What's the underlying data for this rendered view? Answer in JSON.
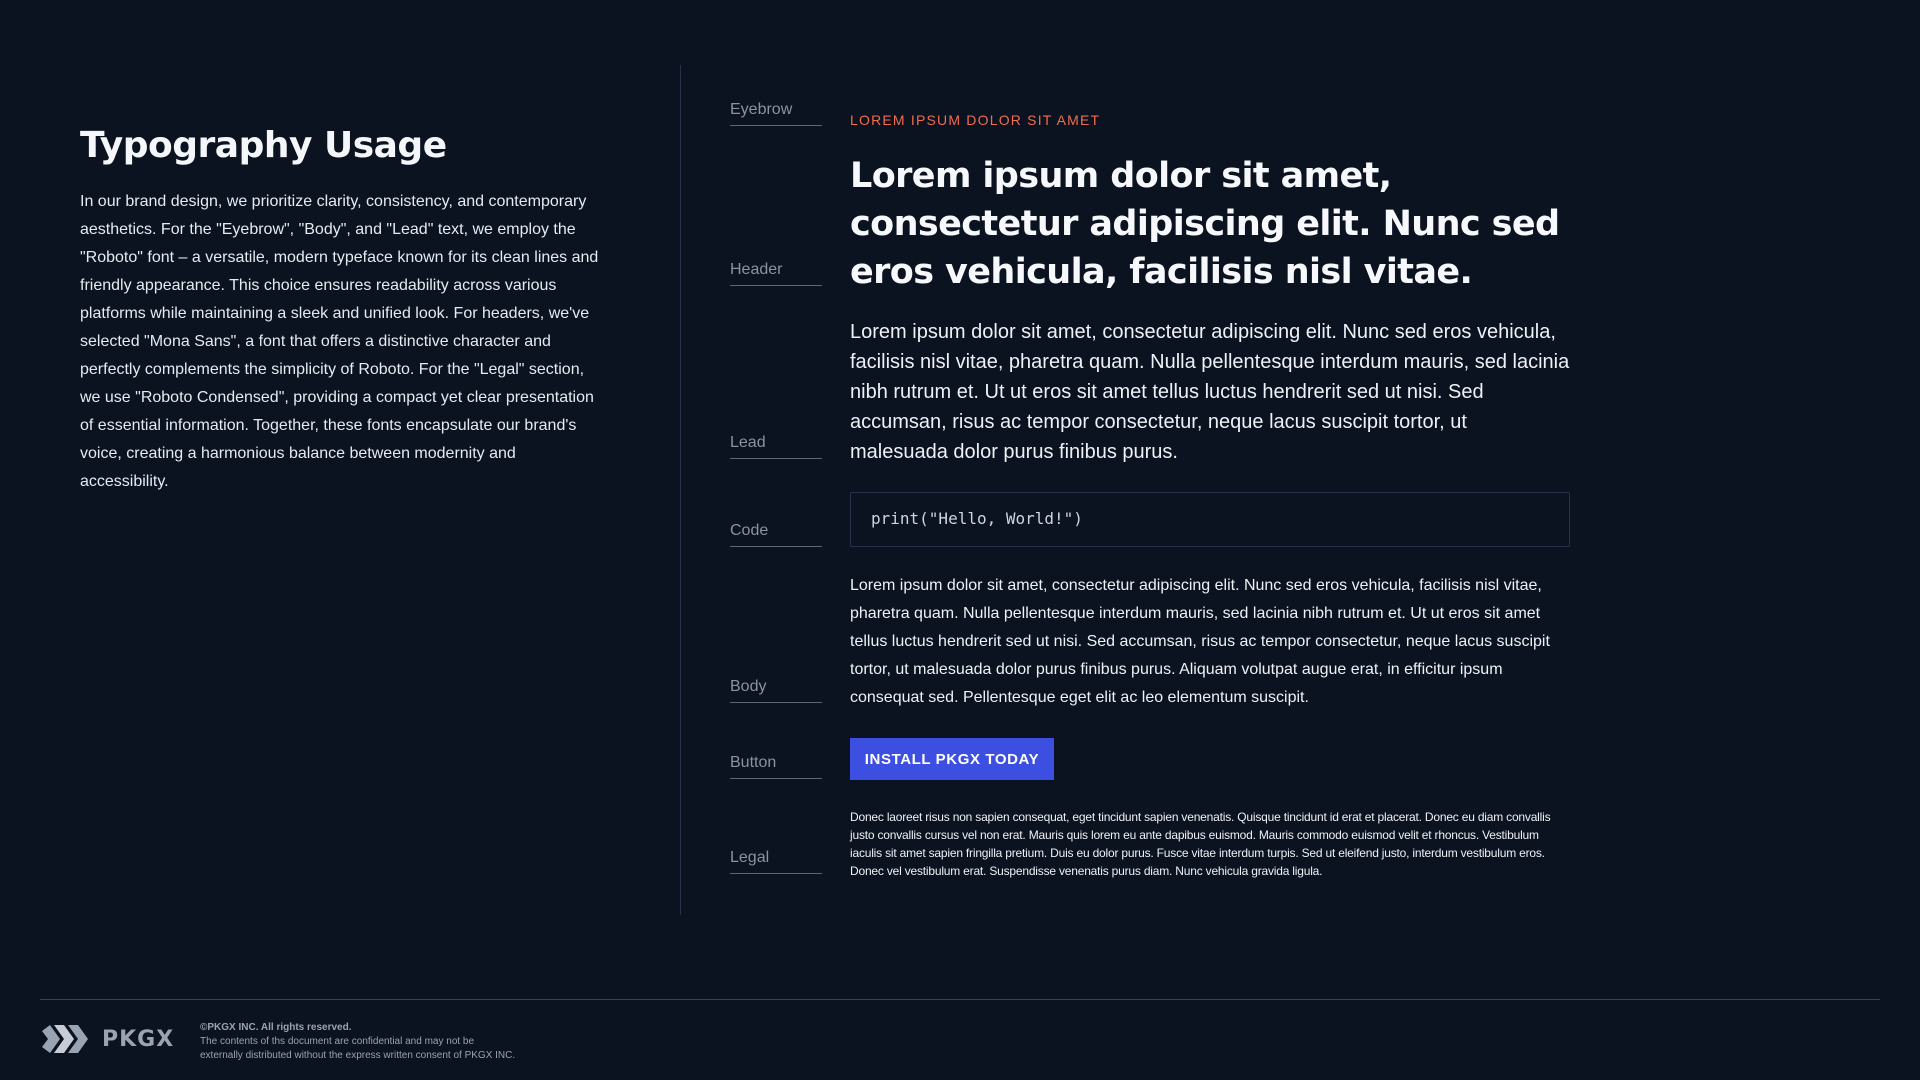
{
  "left": {
    "title": "Typography Usage",
    "description": "In our brand design, we prioritize clarity, consistency, and contemporary aesthetics. For the \"Eyebrow\", \"Body\", and \"Lead\" text, we employ the \"Roboto\" font – a versatile, modern typeface known for its clean lines and friendly appearance. This choice ensures readability across various platforms while maintaining a sleek and unified look. For headers, we've selected \"Mona Sans\", a font that offers a distinctive character and perfectly complements the simplicity of Roboto. For the \"Legal\" section, we use \"Roboto Condensed\", providing a compact yet clear presentation of essential information. Together, these fonts encapsulate our brand's voice, creating a harmonious balance between modernity and accessibility."
  },
  "labels": {
    "eyebrow": "Eyebrow",
    "header": "Header",
    "lead": "Lead",
    "code": "Code",
    "body": "Body",
    "button": "Button",
    "legal": "Legal"
  },
  "samples": {
    "eyebrow": "LOREM IPSUM DOLOR SIT AMET",
    "header": "Lorem ipsum dolor sit amet, consectetur adipiscing elit. Nunc sed eros vehicula, facilisis nisl vitae.",
    "lead": "Lorem ipsum dolor sit amet, consectetur adipiscing elit. Nunc sed eros vehicula, facilisis nisl vitae, pharetra quam. Nulla pellentesque interdum mauris, sed lacinia nibh rutrum et. Ut ut eros sit amet tellus luctus hendrerit sed ut nisi. Sed accumsan, risus ac tempor consectetur, neque lacus suscipit tortor, ut malesuada dolor purus finibus purus.",
    "code": "print(\"Hello, World!\")",
    "body": "Lorem ipsum dolor sit amet, consectetur adipiscing elit. Nunc sed eros vehicula, facilisis nisl vitae, pharetra quam. Nulla pellentesque interdum mauris, sed lacinia nibh rutrum et. Ut ut eros sit amet tellus luctus hendrerit sed ut nisi. Sed accumsan, risus ac tempor consectetur, neque lacus suscipit tortor, ut malesuada dolor purus finibus purus. Aliquam volutpat augue erat, in efficitur ipsum consequat sed. Pellentesque eget elit ac leo elementum suscipit.",
    "button": "INSTALL PKGX TODAY",
    "legal": "Donec laoreet risus non sapien consequat, eget tincidunt sapien venenatis. Quisque tincidunt id erat et placerat. Donec eu diam convallis justo convallis cursus vel non erat. Mauris quis lorem eu ante dapibus euismod. Mauris commodo euismod velit et rhoncus. Vestibulum iaculis sit amet sapien fringilla pretium. Duis eu dolor purus. Fusce vitae interdum turpis. Sed ut eleifend justo, interdum vestibulum eros. Donec vel vestibulum erat. Suspendisse venenatis purus diam. Nunc vehicula gravida ligula."
  },
  "footer": {
    "logo_text": "PKGX",
    "logo_icon": "pkgx-logo-icon",
    "rights": "©PKGX INC. All rights reserved.",
    "confidential_line1": "The contents of ths document are confidential and may not be",
    "confidential_line2": "externally distributed without the express written consent of PKGX INC."
  },
  "colors": {
    "background": "#0b1220",
    "eyebrow": "#f26c4f",
    "button": "#3d4fe0",
    "label": "#8a93a3"
  }
}
